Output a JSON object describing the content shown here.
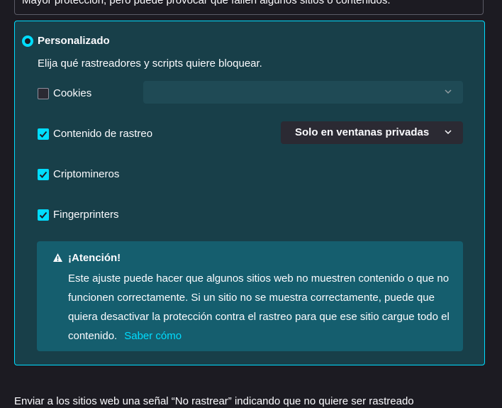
{
  "previous_option": {
    "description": "Mayor protección, pero puede provocar que fallen algunos sitios o contenidos."
  },
  "custom": {
    "title": "Personalizado",
    "selected": true,
    "description": "Elija qué rastreadores y scripts quiere bloquear.",
    "options": [
      {
        "label": "Cookies",
        "checked": false
      },
      {
        "label": "Contenido de rastreo",
        "checked": true
      },
      {
        "label": "Criptomineros",
        "checked": true
      },
      {
        "label": "Fingerprinters",
        "checked": true
      }
    ],
    "cookies_dropdown": {
      "value": "",
      "disabled": true
    },
    "tracking_dropdown": {
      "value": "Solo en ventanas privadas"
    }
  },
  "warning": {
    "title": "¡Atención!",
    "body": "Este ajuste puede hacer que algunos sitios web no muestren contenido o que no funcionen correctamente. Si un sitio no se muestra correctamente, puede que quiera desactivar la protección contra el rastreo para que ese sitio cargue todo el contenido.",
    "link": "Saber cómo"
  },
  "footer": {
    "dnt_text": "Enviar a los sitios web una señal “No rastrear” indicando que no quiere ser rastreado"
  },
  "colors": {
    "accent": "#00ddff",
    "panel_bg": "#183f49",
    "warning_bg": "#155e6e",
    "page_bg": "#1c1b22"
  }
}
